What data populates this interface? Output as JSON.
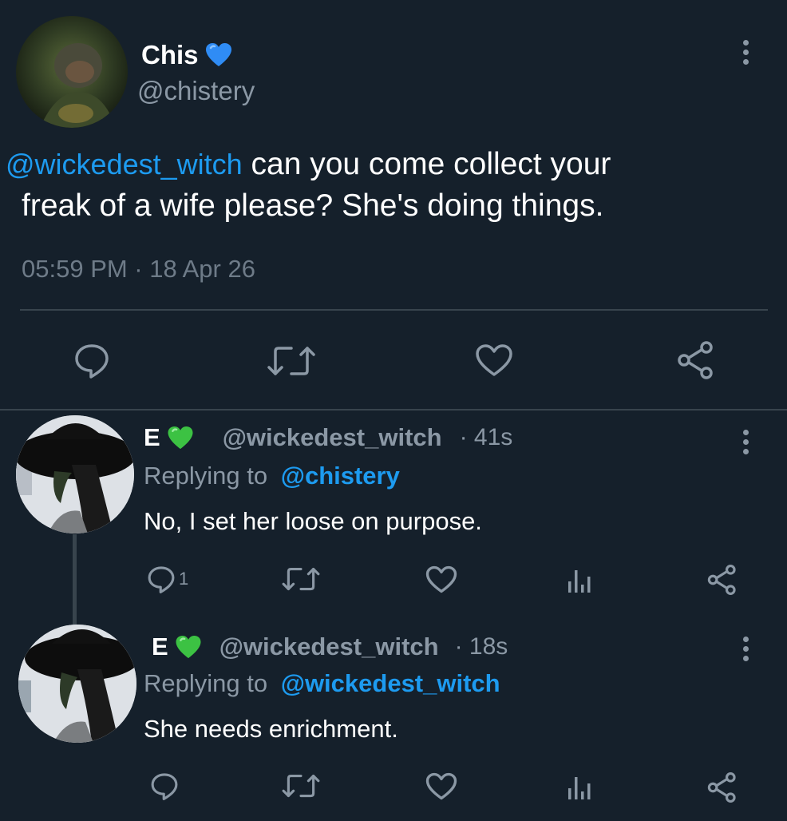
{
  "colors": {
    "background": "#15202b",
    "text": "#ffffff",
    "secondary": "#8b98a5",
    "mention": "#1d9bf0",
    "divider": "#38444d"
  },
  "main_tweet": {
    "display_name": "Chis",
    "badge": "💙",
    "handle": "@chistery",
    "mention": "@wickedest_witch",
    "text_line1": "can you come collect your",
    "text_line2": "freak of a wife please? She's doing things.",
    "timestamp": "05:59 PM · 18 Apr 26",
    "actions": [
      "reply-icon",
      "retweet-icon",
      "like-icon",
      "share-icon"
    ]
  },
  "replies": [
    {
      "display_name": "E",
      "badge": "💚",
      "handle": "@wickedest_witch",
      "time": "· 41s",
      "replying_prefix": "Replying to",
      "replying_handle": "@chistery",
      "text": "No, I set her loose on purpose.",
      "reply_count": "1"
    },
    {
      "display_name": "E",
      "badge": "💚",
      "handle": "@wickedest_witch",
      "time": "· 18s",
      "replying_prefix": "Replying to",
      "replying_handle": "@wickedest_witch",
      "text": "She needs enrichment.",
      "reply_count": ""
    }
  ]
}
